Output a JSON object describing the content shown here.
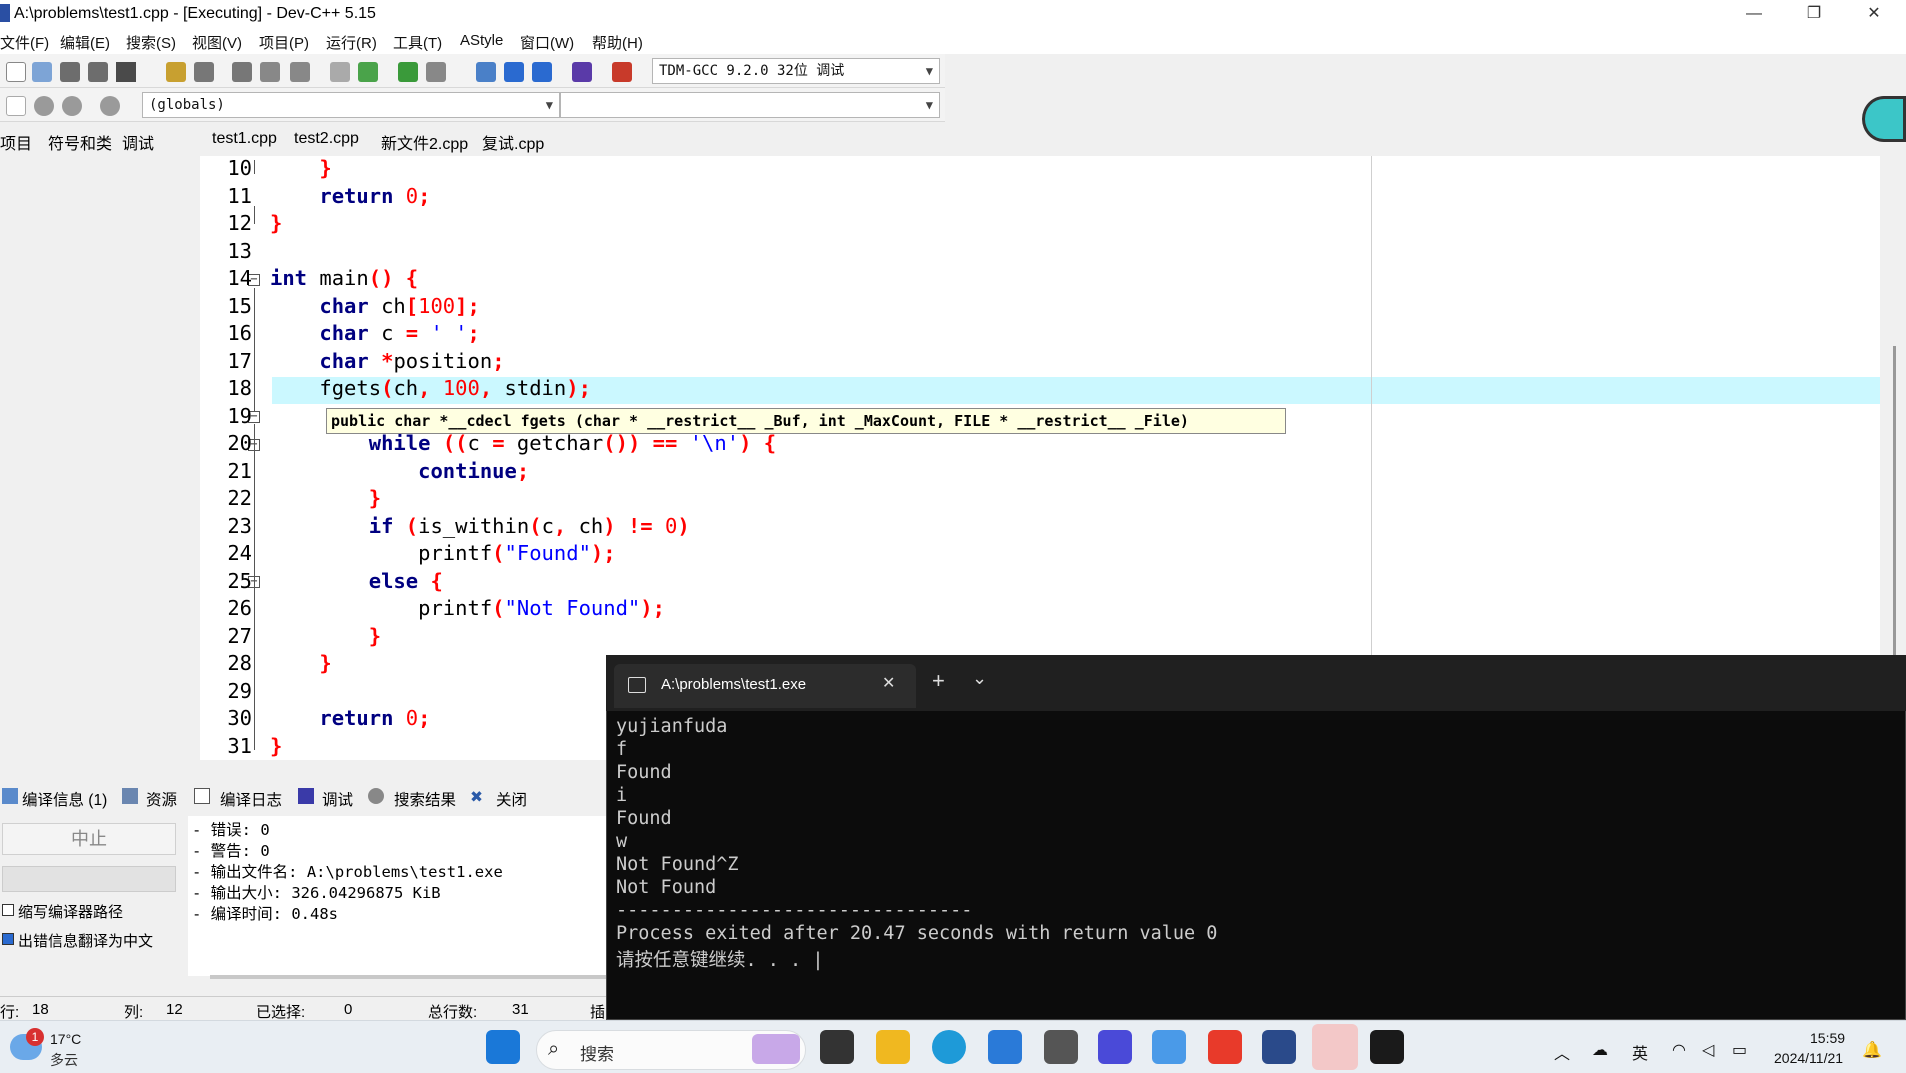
{
  "window": {
    "title": "A:\\problems\\test1.cpp - [Executing] - Dev-C++ 5.15",
    "minimize": "—",
    "restore": "❐",
    "close": "✕"
  },
  "menu": [
    "文件(F)",
    "编辑(E)",
    "搜索(S)",
    "视图(V)",
    "项目(P)",
    "运行(R)",
    "工具(T)",
    "AStyle",
    "窗口(W)",
    "帮助(H)"
  ],
  "toolbar": {
    "compiler": "TDM-GCC 9.2.0 32位 调试",
    "scope": "(globals)",
    "function_select": ""
  },
  "left_tabs": [
    "项目",
    "符号和类",
    "调试"
  ],
  "editor_tabs": [
    "test1.cpp",
    "test2.cpp",
    "新文件2.cpp",
    "复试.cpp"
  ],
  "code": {
    "line_numbers": [
      "10",
      "11",
      "12",
      "13",
      "14",
      "15",
      "16",
      "17",
      "18",
      "19",
      "20",
      "21",
      "22",
      "23",
      "24",
      "25",
      "26",
      "27",
      "28",
      "29",
      "30",
      "31"
    ],
    "tooltip": "public char *__cdecl fgets (char * __restrict__ _Buf, int _MaxCount, FILE * __restrict__ _File)"
  },
  "bottom_tabs": [
    "编译信息 (1)",
    "资源",
    "编译日志",
    "调试",
    "搜索结果",
    "关闭"
  ],
  "bottom": {
    "stop": "中止",
    "option1": "缩写编译器路径",
    "option2": "出错信息翻译为中文",
    "log": [
      "- 错误: 0",
      "- 警告: 0",
      "- 输出文件名: A:\\problems\\test1.exe",
      "- 输出大小: 326.04296875 KiB",
      "- 编译时间: 0.48s"
    ]
  },
  "status": {
    "row_label": "行:",
    "row": "18",
    "col_label": "列:",
    "col": "12",
    "sel_label": "已选择:",
    "sel": "0",
    "total_label": "总行数:",
    "total": "31",
    "ins": "插"
  },
  "terminal": {
    "title": "A:\\problems\\test1.exe",
    "close": "✕",
    "plus": "+",
    "chev": "⌄",
    "lines": [
      "yujianfuda",
      "f",
      "Found",
      "i",
      "Found",
      "w",
      "Not Found^Z",
      "Not Found",
      "--------------------------------",
      "Process exited after 20.47 seconds with return value 0",
      "请按任意键继续. . . |"
    ]
  },
  "taskbar": {
    "weather_temp": "17°C",
    "weather_desc": "多云",
    "weather_badge": "1",
    "search": "搜索",
    "ime": "英",
    "time": "15:59",
    "date": "2024/11/21"
  }
}
